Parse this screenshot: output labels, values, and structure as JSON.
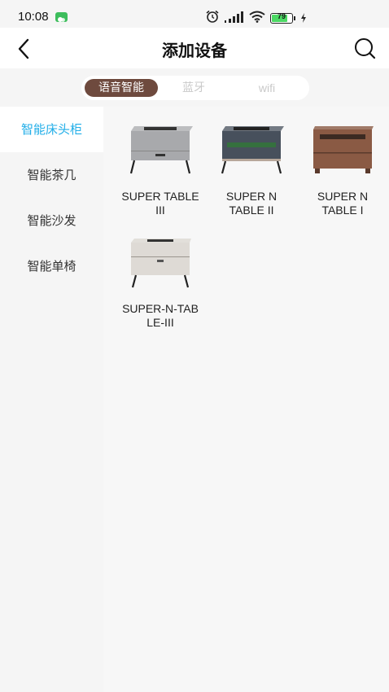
{
  "status_bar": {
    "time": "10:08",
    "battery_level": "79",
    "battery_fraction": 0.79,
    "icons": [
      "wechat-icon",
      "alarm-icon",
      "signal-icon",
      "wifi-icon",
      "battery-icon",
      "charging-icon"
    ]
  },
  "header": {
    "title": "添加设备",
    "back_icon": "chevron-left-icon",
    "search_icon": "search-icon"
  },
  "tabs": [
    {
      "label": "语音智能",
      "selected": true
    },
    {
      "label": "蓝牙",
      "selected": false
    },
    {
      "label": "wifi",
      "selected": false
    }
  ],
  "sidebar": {
    "items": [
      {
        "label": "智能床头柜",
        "selected": true
      },
      {
        "label": "智能茶几",
        "selected": false
      },
      {
        "label": "智能沙发",
        "selected": false
      },
      {
        "label": "智能单椅",
        "selected": false
      }
    ]
  },
  "products": [
    {
      "name": "SUPER TABLE III",
      "lines": [
        "SUPER TABLE",
        "III"
      ],
      "color": "#a8a9ac"
    },
    {
      "name": "SUPER N TABLE II",
      "lines": [
        "SUPER N",
        "TABLE II"
      ],
      "color": "#47505c"
    },
    {
      "name": "SUPER N TABLE I",
      "lines": [
        "SUPER N",
        "TABLE I"
      ],
      "color": "#8a5a44"
    },
    {
      "name": "SUPER-N-TABLE-III",
      "lines": [
        "SUPER-N-TAB",
        "LE-III"
      ],
      "color": "#dedad5"
    }
  ],
  "colors": {
    "accent_tab": "#6e4a3e",
    "active_sidebar_text": "#21aee8",
    "inactive_tab_text": "#c9c9c9"
  }
}
